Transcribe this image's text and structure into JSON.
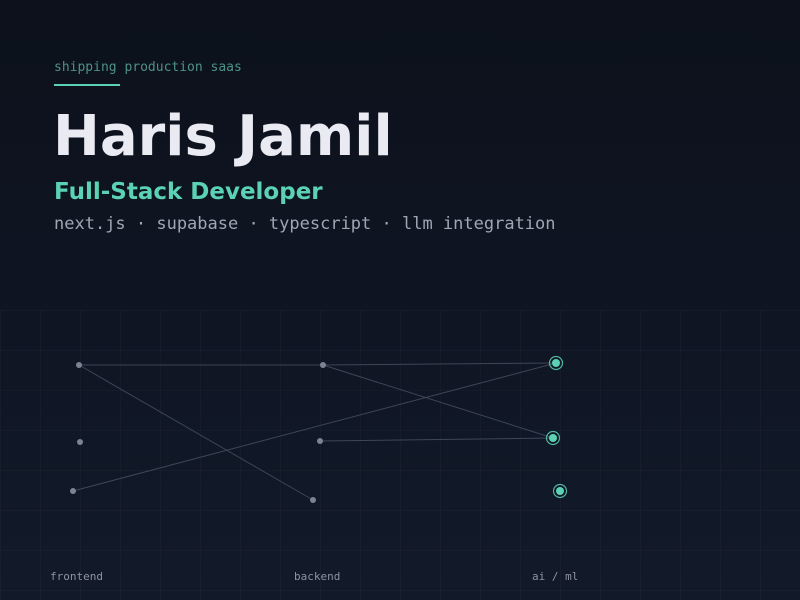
{
  "header": {
    "eyebrow": "shipping production saas",
    "name": "Haris Jamil",
    "role": "Full-Stack Developer",
    "stack": "next.js · supabase · typescript · llm integration"
  },
  "graph": {
    "layers": [
      {
        "label": "frontend",
        "nodes": 3
      },
      {
        "label": "backend",
        "nodes": 3
      },
      {
        "label": "ai / ml",
        "nodes": 3
      }
    ],
    "edges": [
      [
        "frontend-1",
        "backend-1"
      ],
      [
        "frontend-1",
        "backend-3"
      ],
      [
        "frontend-3",
        "ai-1"
      ],
      [
        "backend-1",
        "ai-1"
      ],
      [
        "backend-1",
        "ai-2"
      ],
      [
        "backend-2",
        "ai-2"
      ]
    ]
  },
  "colors": {
    "accent": "#5ad2b3",
    "node": "#7c8393",
    "edge": "#3d4758",
    "title": "#e9eaf2",
    "muted": "#a0a6b6",
    "background": "#0e1420"
  }
}
